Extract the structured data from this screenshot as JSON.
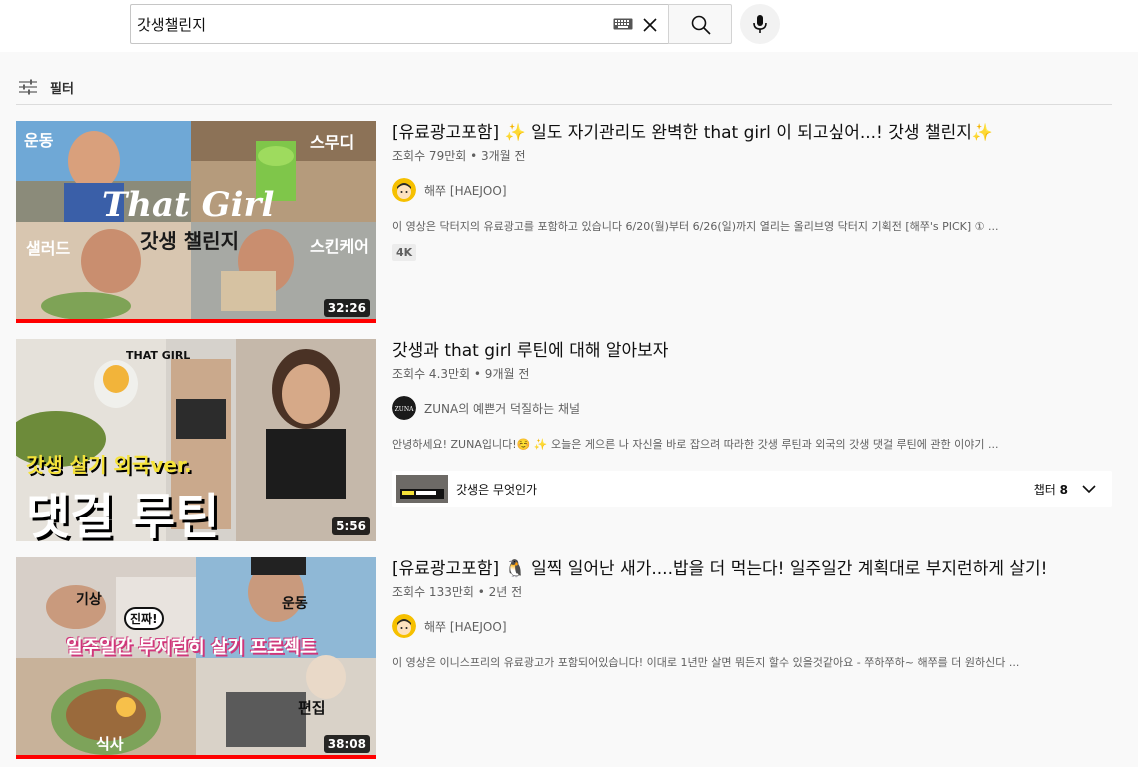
{
  "search": {
    "query": "갓생챌린지"
  },
  "filter": {
    "label": "필터"
  },
  "videos": [
    {
      "title": "[유료광고포함] ✨ 일도 자기관리도 완벽한 that girl 이 되고싶어...! 갓생 챌린지✨",
      "meta": "조회수 79만회 • 3개월 전",
      "channel": "해쭈 [HAEJOO]",
      "description": "이 영상은 닥터지의 유료광고를 포함하고 있습니다 6/20(월)부터 6/26(일)까지 열리는 올리브영 닥터지 기획전 [해쭈's PICK] ① ...",
      "badge": "4K",
      "duration": "32:26",
      "thumb_text": {
        "tl": "운동",
        "tr": "스무디",
        "center": "That Girl",
        "center2": "갓생 챌린지",
        "bl": "샐러드",
        "br": "스킨케어"
      }
    },
    {
      "title": "갓생과 that girl 루틴에 대해 알아보자",
      "meta": "조회수 4.3만회 • 9개월 전",
      "channel": "ZUNA의 예쁜거 덕질하는 채널",
      "channel_logo": "ZUNA",
      "description": "안녕하세요! ZUNA입니다!☺️ ✨ 오늘은 게으른 나 자신을 바로 잡으려 따라한 갓생 루틴과 외국의 갓생 댓걸 루틴에 관한 이야기 ...",
      "duration": "5:56",
      "chapter": {
        "title": "갓생은 무엇인가",
        "count_label": "챕터",
        "count": "8"
      },
      "thumb_text": {
        "top": "THAT GIRL",
        "line1": "갓생 살기 외국ver.",
        "line2": "댓걸 루틴"
      }
    },
    {
      "title": "[유료광고포함] 🐧 일찍 일어난 새가....밥을 더 먹는다! 일주일간 계획대로 부지런하게 살기!",
      "meta": "조회수 133만회 • 2년 전",
      "channel": "해쭈 [HAEJOO]",
      "description": "이 영상은 이니스프리의 유료광고가 포함되어있습니다! 이대로 1년만 살면 뭐든지 할수 있을것같아요 - 쭈하쭈하~ 해쭈를 더 원하신다 ...",
      "duration": "38:08",
      "thumb_text": {
        "tl": "기상",
        "tr": "운동",
        "bubble": "진짜!",
        "center": "일주일간 부지런히 살기 프로젝트",
        "bl": "식사",
        "br": "편집"
      }
    }
  ],
  "colors": {
    "progress": "#ff0000",
    "background": "#f9f9f9"
  }
}
